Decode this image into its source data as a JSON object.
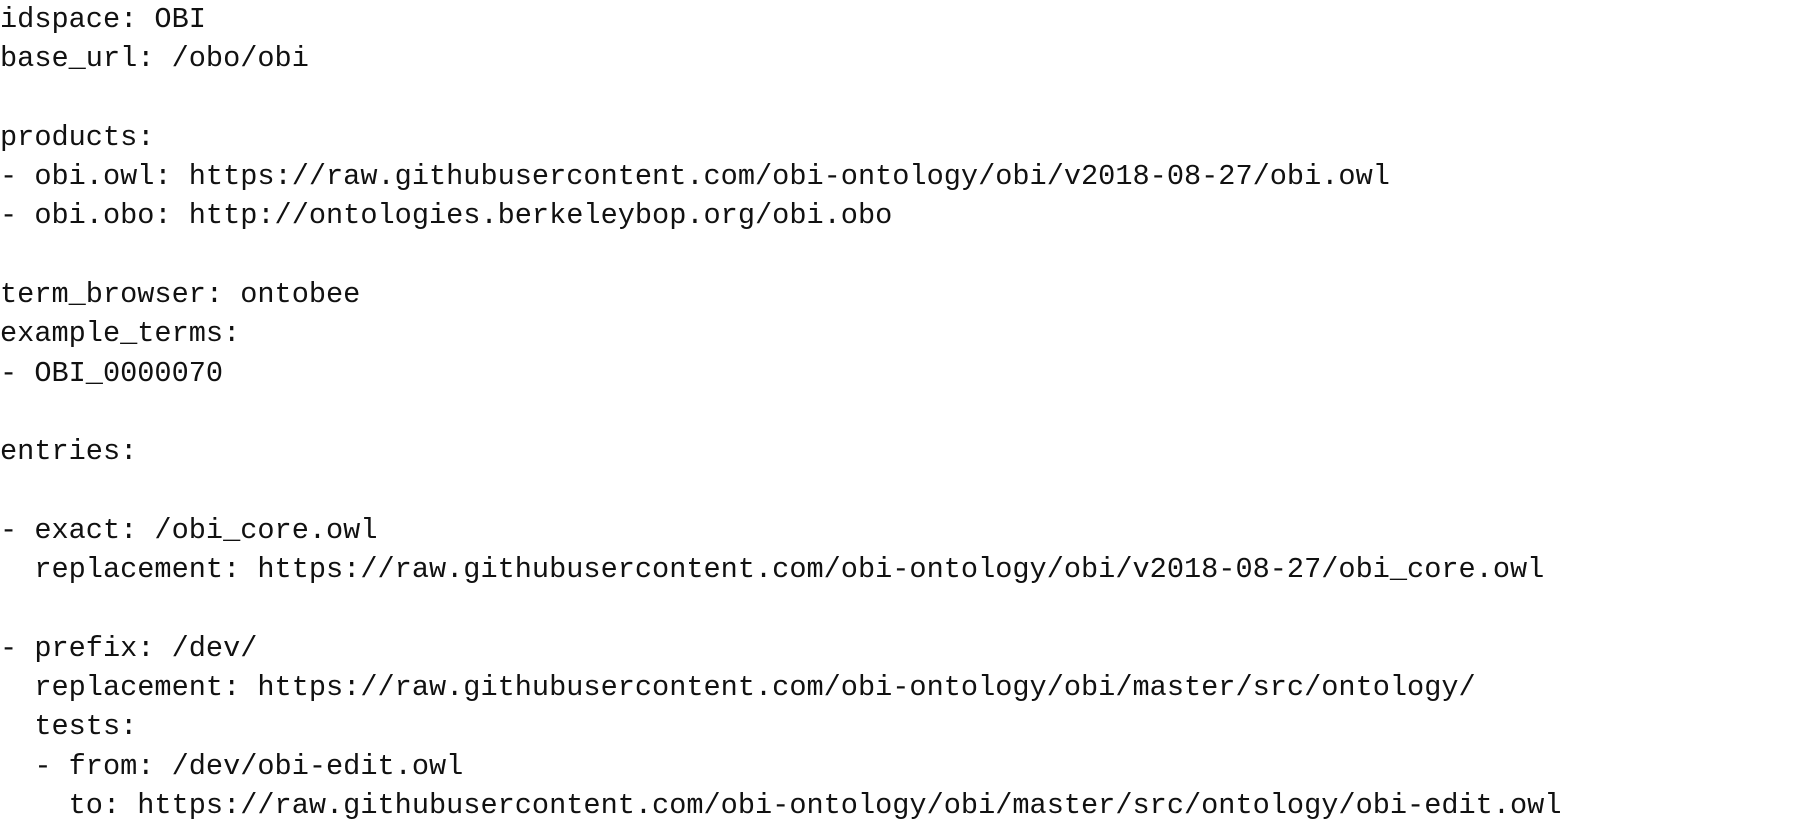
{
  "document": {
    "lines": [
      "idspace: OBI",
      "base_url: /obo/obi",
      "",
      "products:",
      "- obi.owl: https://raw.githubusercontent.com/obi-ontology/obi/v2018-08-27/obi.owl",
      "- obi.obo: http://ontologies.berkeleybop.org/obi.obo",
      "",
      "term_browser: ontobee",
      "example_terms:",
      "- OBI_0000070",
      "",
      "entries:",
      "",
      "- exact: /obi_core.owl",
      "  replacement: https://raw.githubusercontent.com/obi-ontology/obi/v2018-08-27/obi_core.owl",
      "",
      "- prefix: /dev/",
      "  replacement: https://raw.githubusercontent.com/obi-ontology/obi/master/src/ontology/",
      "  tests:",
      "  - from: /dev/obi-edit.owl",
      "    to: https://raw.githubusercontent.com/obi-ontology/obi/master/src/ontology/obi-edit.owl"
    ]
  }
}
